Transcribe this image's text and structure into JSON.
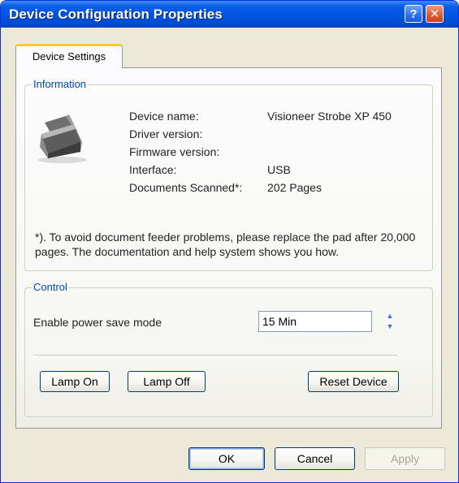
{
  "window": {
    "title": "Device Configuration Properties",
    "help_glyph": "?",
    "close_glyph": "✕"
  },
  "tabs": [
    {
      "label": "Device Settings"
    }
  ],
  "information": {
    "legend": "Information",
    "rows": [
      {
        "label": "Device name:",
        "value": "Visioneer Strobe XP 450"
      },
      {
        "label": "Driver version:",
        "value": ""
      },
      {
        "label": "Firmware version:",
        "value": ""
      },
      {
        "label": "Interface:",
        "value": "USB"
      },
      {
        "label": "Documents Scanned*:",
        "value": "202 Pages"
      }
    ],
    "note": "*). To avoid document feeder problems, please replace the pad after 20,000 pages. The documentation and help system shows you how."
  },
  "control": {
    "legend": "Control",
    "power_save_label": "Enable power save mode",
    "power_save_value": "15 Min",
    "lamp_on": "Lamp On",
    "lamp_off": "Lamp Off",
    "reset_device": "Reset Device"
  },
  "footer": {
    "ok": "OK",
    "cancel": "Cancel",
    "apply": "Apply"
  }
}
